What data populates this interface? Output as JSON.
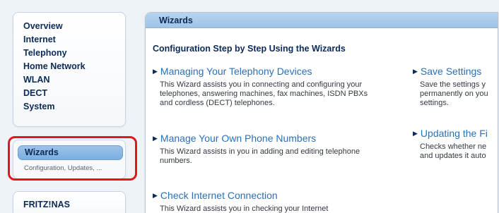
{
  "sidebar": {
    "nav": [
      "Overview",
      "Internet",
      "Telephony",
      "Home Network",
      "WLAN",
      "DECT",
      "System"
    ],
    "wizards": {
      "label": "Wizards",
      "sublabel": "Configuration, Updates, ..."
    },
    "nas": "FRITZ!NAS"
  },
  "highlight_color": "#e2161b",
  "main": {
    "header": "Wizards",
    "section_title": "Configuration Step by Step Using the Wizards",
    "items_left": [
      {
        "title": "Managing Your Telephony Devices",
        "desc": "This Wizard assists you in connecting and configuring your\ntelephones, answering machines, fax machines, ISDN PBXs\nand cordless (DECT) telephones."
      },
      {
        "title": "Manage Your Own Phone Numbers",
        "desc": "This Wizard assists in you in adding and editing telephone\nnumbers."
      },
      {
        "title": "Check Internet Connection",
        "desc": "This Wizard assists you in checking your Internet"
      }
    ],
    "items_right": [
      {
        "title": "Save Settings",
        "desc": "Save the settings y\npermanently on you\nsettings."
      },
      {
        "title": "Updating the Fi",
        "desc": "Checks whether ne\nand updates it auto"
      }
    ]
  }
}
